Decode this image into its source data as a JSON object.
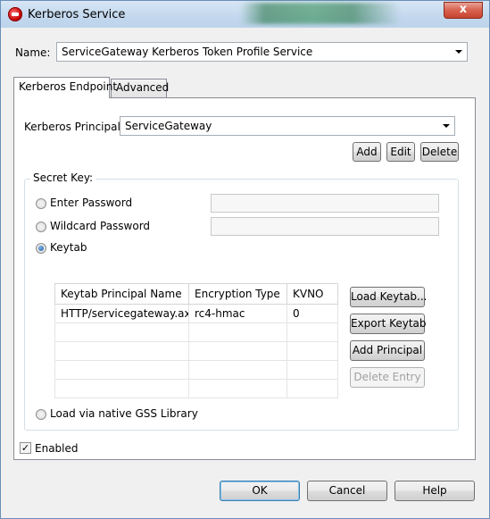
{
  "window": {
    "title": "Kerberos Service",
    "close_glyph": "x"
  },
  "name_row": {
    "label": "Name:",
    "value": "ServiceGateway Kerberos Token Profile Service"
  },
  "tabs": [
    {
      "label": "Kerberos Endpoint",
      "active": true
    },
    {
      "label": "Advanced",
      "active": false
    }
  ],
  "principal": {
    "label": "Kerberos Principal:",
    "value": "ServiceGateway",
    "add_label": "Add",
    "edit_label": "Edit",
    "delete_label": "Delete"
  },
  "secret_key": {
    "title": "Secret Key:",
    "options": [
      {
        "label": "Enter Password",
        "selected": false
      },
      {
        "label": "Wildcard Password",
        "selected": false
      },
      {
        "label": "Keytab",
        "selected": true
      },
      {
        "label": "Load via native GSS Library",
        "selected": false
      }
    ]
  },
  "keytab_table": {
    "columns": [
      "Keytab Principal Name",
      "Encryption Type",
      "KVNO"
    ],
    "rows": [
      [
        "HTTP/servicegateway.ax...",
        "rc4-hmac",
        "0"
      ],
      [
        "",
        "",
        ""
      ],
      [
        "",
        "",
        ""
      ],
      [
        "",
        "",
        ""
      ],
      [
        "",
        "",
        ""
      ]
    ]
  },
  "keytab_buttons": {
    "load": "Load Keytab...",
    "export": "Export Keytab",
    "add_principal": "Add Principal",
    "delete_entry": "Delete Entry"
  },
  "enabled": {
    "label": "Enabled",
    "checked": true,
    "check_glyph": "✓"
  },
  "footer": {
    "ok": "OK",
    "cancel": "Cancel",
    "help": "Help"
  }
}
